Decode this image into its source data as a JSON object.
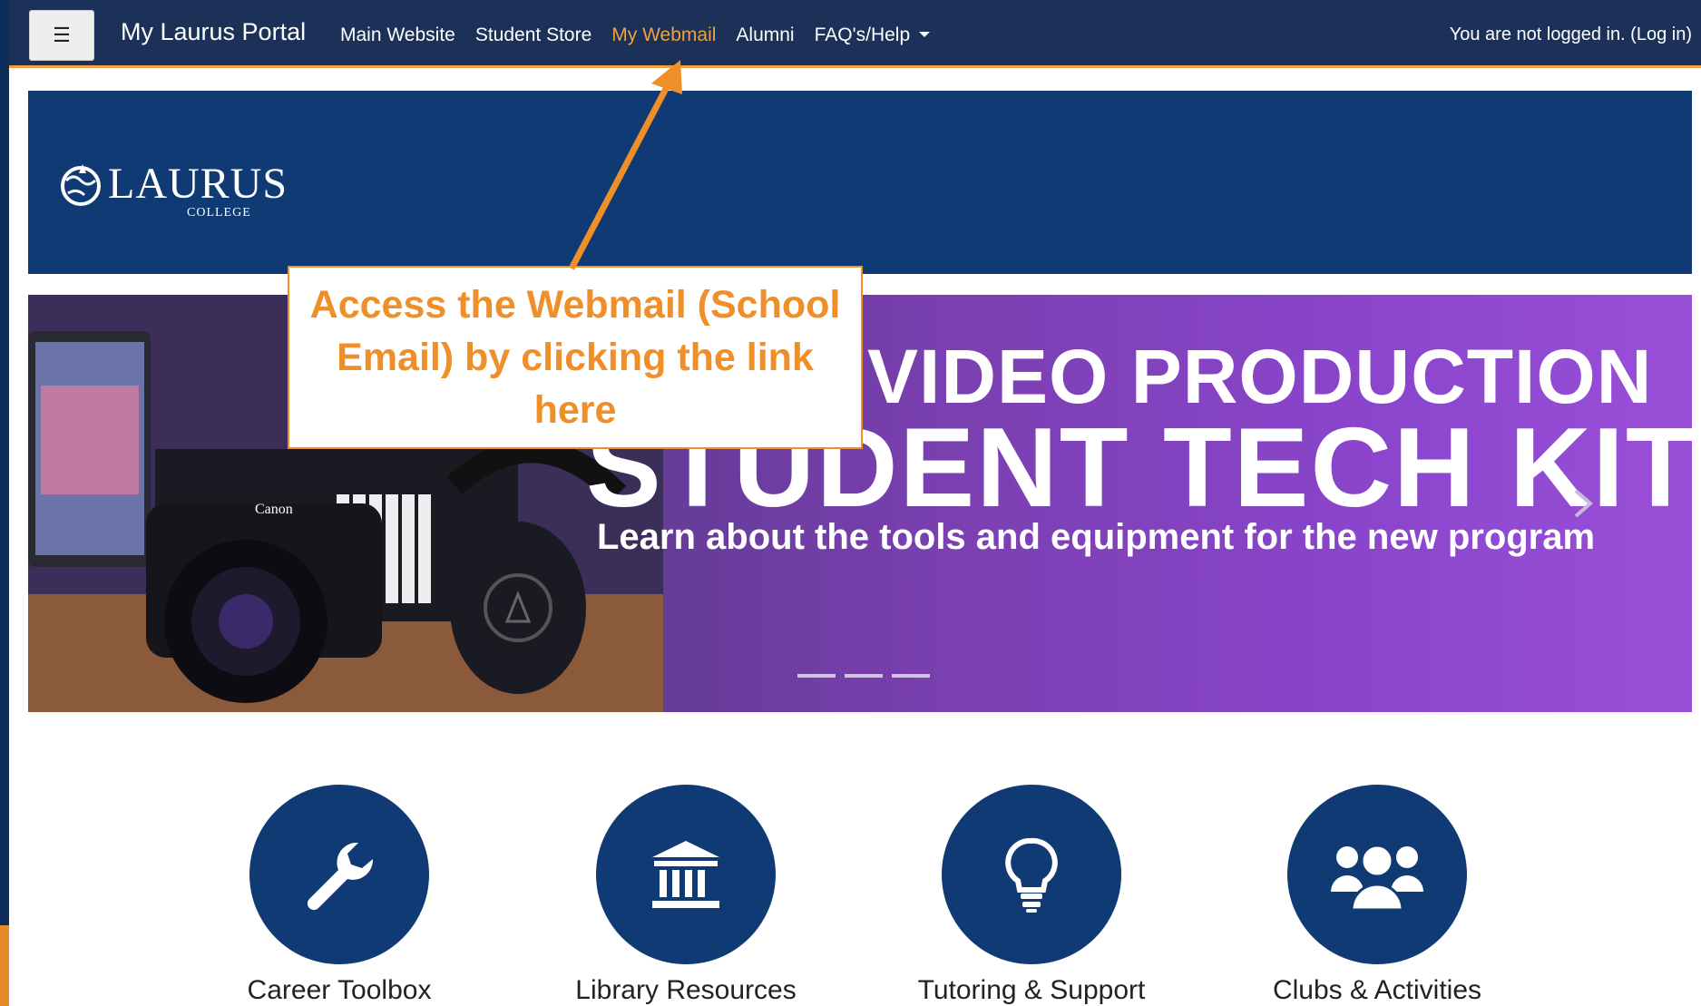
{
  "navbar": {
    "menu_icon": "hamburger-icon",
    "brand": "My Laurus Portal",
    "links": [
      {
        "label": "Main Website",
        "active": false
      },
      {
        "label": "Student Store",
        "active": false
      },
      {
        "label": "My Webmail",
        "active": true
      },
      {
        "label": "Alumni",
        "active": false
      },
      {
        "label": "FAQ's/Help",
        "active": false
      }
    ],
    "login_text": "You are not logged in. (Log in)"
  },
  "logo": {
    "name": "LAURUS",
    "sub": "COLLEGE"
  },
  "carousel": {
    "line1": "VIDEO PRODUCTION",
    "line2": "STUDENT TECH KIT",
    "line3": "Learn about the tools and equipment for the new program",
    "camera_brand": "Canon",
    "slides": 3
  },
  "tiles": [
    {
      "label": "Career Toolbox",
      "icon": "wrench-icon"
    },
    {
      "label": "Library Resources",
      "icon": "library-icon"
    },
    {
      "label": "Tutoring & Support",
      "icon": "lightbulb-icon"
    },
    {
      "label": "Clubs & Activities",
      "icon": "group-icon"
    }
  ],
  "callout": {
    "text": "Access the Webmail (School Email) by clicking the link here"
  },
  "colors": {
    "navbar": "#1b3158",
    "brand_blue": "#0f3a74",
    "accent_orange": "#ef8f2a",
    "active_link": "#f0a043"
  }
}
